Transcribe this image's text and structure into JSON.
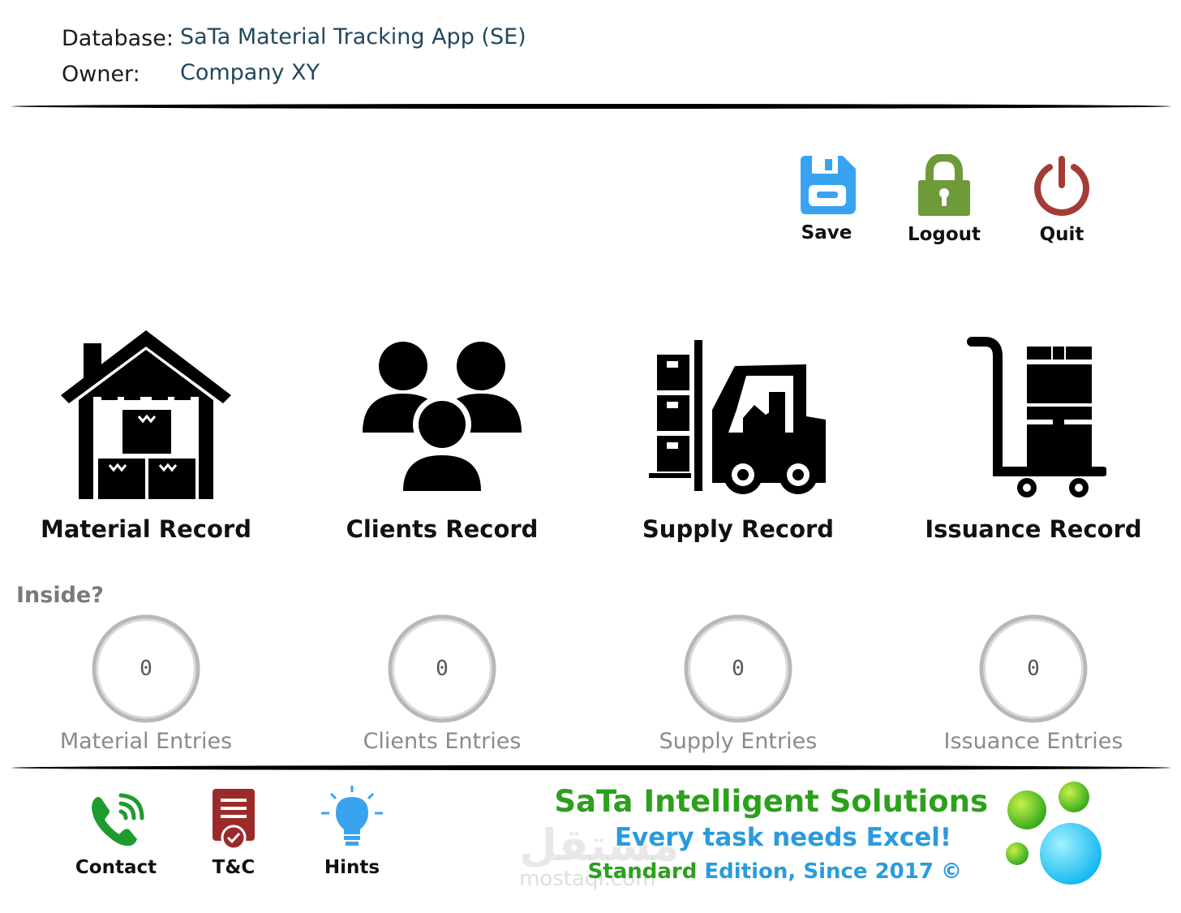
{
  "header": {
    "database_label": "Database:",
    "database_value": "SaTa Material Tracking App (SE)",
    "owner_label": "Owner:",
    "owner_value": "Company XY"
  },
  "toolbar": {
    "save_label": "Save",
    "logout_label": "Logout",
    "quit_label": "Quit"
  },
  "modules": [
    {
      "label": "Material Record",
      "icon": "warehouse-icon"
    },
    {
      "label": "Clients Record",
      "icon": "people-group-icon"
    },
    {
      "label": "Supply Record",
      "icon": "forklift-icon"
    },
    {
      "label": "Issuance Record",
      "icon": "hand-truck-icon"
    }
  ],
  "inside_label": "Inside?",
  "counters": [
    {
      "value": "0",
      "label": "Material Entries"
    },
    {
      "value": "0",
      "label": "Clients Entries"
    },
    {
      "value": "0",
      "label": "Supply Entries"
    },
    {
      "value": "0",
      "label": "Issuance Entries"
    }
  ],
  "footer": {
    "contact_label": "Contact",
    "tc_label": "T&C",
    "hints_label": "Hints",
    "brand_title": "SaTa Intelligent Solutions",
    "brand_tagline": "Every task needs Excel!",
    "edition_word": "Standard",
    "edition_rest": " Edition, Since 2017 ©",
    "watermark_ar": "مستقل",
    "watermark_lat": "mostaql.com"
  },
  "colors": {
    "save": "#3aa3f0",
    "logout": "#6e9a3a",
    "quit": "#a53b36",
    "brand_green": "#2ca01c",
    "brand_blue": "#2a9bdd"
  }
}
